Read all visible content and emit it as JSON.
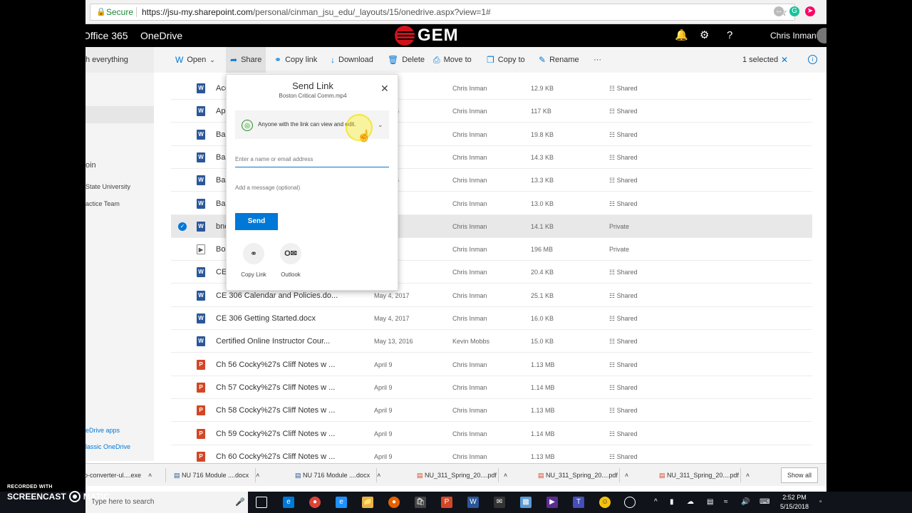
{
  "browser": {
    "secure_label": "Secure",
    "url_host": "https://jsu-my.sharepoint.com",
    "url_path": "/personal/cinman_jsu_edu/_layouts/15/onedrive.aspx?view=1#"
  },
  "suite": {
    "office_label": "Office 365",
    "app_label": "OneDrive",
    "brand": "GEM",
    "user_name": "Chris Inman"
  },
  "search": {
    "partial_text": "h everything"
  },
  "commands": {
    "open": "Open",
    "share": "Share",
    "copy_link": "Copy link",
    "download": "Download",
    "delete": "Delete",
    "move_to": "Move to",
    "copy_to": "Copy to",
    "rename": "Rename",
    "more": "···",
    "selected": "1 selected"
  },
  "leftnav": {
    "partial_1": "oin",
    "partial_2": "State University",
    "partial_3": "actice Team",
    "link_apps": "eDrive apps",
    "link_classic": "lassic OneDrive"
  },
  "files": [
    {
      "name": "Acc",
      "date": "2017",
      "owner": "Chris Inman",
      "size": "12.9 KB",
      "share": "Shared",
      "type": "word"
    },
    {
      "name": "Ap",
      "date": "24, 2016",
      "owner": "Chris Inman",
      "size": "117 KB",
      "share": "Shared",
      "type": "word"
    },
    {
      "name": "Bas",
      "date": "4, 2017",
      "owner": "Chris Inman",
      "size": "19.8 KB",
      "share": "Shared",
      "type": "word"
    },
    {
      "name": "Bas",
      "date": "4, 2017",
      "owner": "Chris Inman",
      "size": "14.3 KB",
      "share": "Shared",
      "type": "word"
    },
    {
      "name": "Bas",
      "date": "24, 2016",
      "owner": "Chris Inman",
      "size": "13.3 KB",
      "share": "Shared",
      "type": "word"
    },
    {
      "name": "Bas",
      "date": "4, 2017",
      "owner": "Chris Inman",
      "size": "13.0 KB",
      "share": "Shared",
      "type": "word"
    },
    {
      "name": "bnc",
      "date": "2017",
      "owner": "Chris Inman",
      "size": "14.1 KB",
      "share": "Private",
      "type": "word"
    },
    {
      "name": "Bos",
      "date": "tes ago",
      "owner": "Chris Inman",
      "size": "196 MB",
      "share": "Private",
      "type": "video"
    },
    {
      "name": "CE",
      "date": "017",
      "owner": "Chris Inman",
      "size": "20.4 KB",
      "share": "Shared",
      "type": "word"
    },
    {
      "name": "CE 306 Calendar and Policies.do...",
      "date": "May 4, 2017",
      "owner": "Chris Inman",
      "size": "25.1 KB",
      "share": "Shared",
      "type": "word"
    },
    {
      "name": "CE 306 Getting Started.docx",
      "date": "May 4, 2017",
      "owner": "Chris Inman",
      "size": "16.0 KB",
      "share": "Shared",
      "type": "word"
    },
    {
      "name": "Certified Online Instructor Cour...",
      "date": "May 13, 2016",
      "owner": "Kevin Mobbs",
      "size": "15.0 KB",
      "share": "Shared",
      "type": "word"
    },
    {
      "name": "Ch 56 Cocky%27s Cliff Notes w ...",
      "date": "April 9",
      "owner": "Chris Inman",
      "size": "1.13 MB",
      "share": "Shared",
      "type": "ppt"
    },
    {
      "name": "Ch 57 Cocky%27s Cliff Notes w ...",
      "date": "April 9",
      "owner": "Chris Inman",
      "size": "1.14 MB",
      "share": "Shared",
      "type": "ppt"
    },
    {
      "name": "Ch 58 Cocky%27s Cliff Notes w ...",
      "date": "April 9",
      "owner": "Chris Inman",
      "size": "1.13 MB",
      "share": "Shared",
      "type": "ppt"
    },
    {
      "name": "Ch 59 Cocky%27s Cliff Notes w ...",
      "date": "April 9",
      "owner": "Chris Inman",
      "size": "1.14 MB",
      "share": "Shared",
      "type": "ppt"
    },
    {
      "name": "Ch 60 Cocky%27s Cliff Notes w ...",
      "date": "April 9",
      "owner": "Chris Inman",
      "size": "1.13 MB",
      "share": "Shared",
      "type": "ppt"
    }
  ],
  "selected_row_index": 6,
  "dialog": {
    "title": "Send Link",
    "filename": "Boston Critical Comm.mp4",
    "permission": "Anyone with the link can view and edit.",
    "to_placeholder": "Enter a name or email address",
    "message_placeholder": "Add a message (optional)",
    "send_label": "Send",
    "copy_link_label": "Copy Link",
    "outlook_label": "Outlook"
  },
  "downloads": [
    {
      "name": "o-converter-ul....exe"
    },
    {
      "name": "NU 716 Module ....docx"
    },
    {
      "name": "NU 716 Module ....docx"
    },
    {
      "name": "NU_311_Spring_20....pdf"
    },
    {
      "name": "NU_311_Spring_20....pdf"
    },
    {
      "name": "NU_311_Spring_20....pdf"
    }
  ],
  "show_all": "Show all",
  "taskbar": {
    "search_placeholder": "Type here to search",
    "time": "2:52 PM",
    "date": "5/15/2018"
  },
  "watermark": {
    "line1": "RECORDED WITH",
    "line2a": "SCREENCAST",
    "line2b": "MATIC"
  },
  "colors": {
    "accent": "#0078d7",
    "brand_red": "#d0121b",
    "word": "#2b579a",
    "ppt": "#d24726"
  }
}
